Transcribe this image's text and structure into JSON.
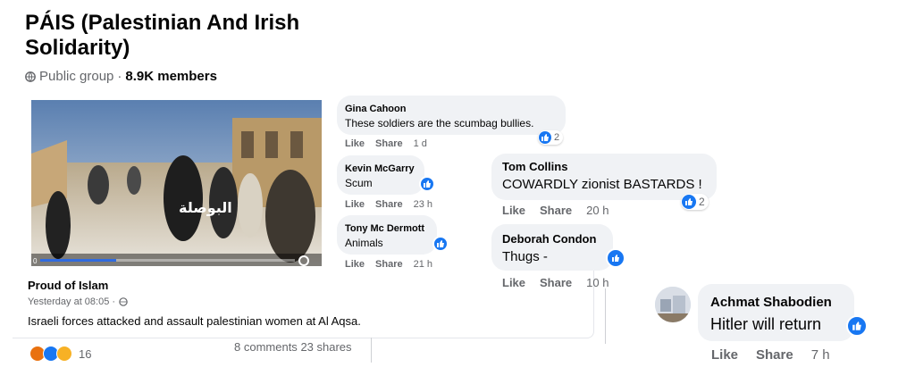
{
  "group": {
    "title": "PÁIS (Palestinian And Irish Solidarity)",
    "privacy": "Public group",
    "separator": "·",
    "members": "8.9K members"
  },
  "post": {
    "author": "Proud of Islam",
    "time": "Yesterday at 08:05 ·",
    "text": "Israeli forces attacked and assault palestinian women at Al Aqsa.",
    "video": {
      "watermark": "البوصلة",
      "time_label": "0"
    },
    "reaction_count": "16",
    "comments": "8 comments",
    "shares": "23 shares"
  },
  "comments_left": [
    {
      "name": "Gina Cahoon",
      "text": "These soldiers are the scumbag bullies.",
      "like": "Like",
      "share": "Share",
      "time": "1 d",
      "likes": "2"
    },
    {
      "name": "Kevin McGarry",
      "text": "Scum",
      "like": "Like",
      "share": "Share",
      "time": "23 h"
    },
    {
      "name": "Tony Mc Dermott",
      "text": "Animals",
      "like": "Like",
      "share": "Share",
      "time": "21 h"
    }
  ],
  "comments_right": [
    {
      "name": "Tom Collins",
      "text": "COWARDLY zionist BASTARDS !",
      "like": "Like",
      "share": "Share",
      "time": "20 h",
      "likes": "2"
    },
    {
      "name": "Deborah Condon",
      "text": "Thugs -",
      "like": "Like",
      "share": "Share",
      "time": "10 h"
    }
  ],
  "comment_far": {
    "name": "Achmat Shabodien",
    "text": "Hitler will return",
    "like": "Like",
    "share": "Share",
    "time": "7 h"
  },
  "colors": {
    "accent": "#1877f2",
    "bubble": "#f0f2f5",
    "secondary_text": "#65676b"
  },
  "icons": [
    "globe-icon",
    "like-icon",
    "angry-icon",
    "sad-icon",
    "settings-icon"
  ]
}
